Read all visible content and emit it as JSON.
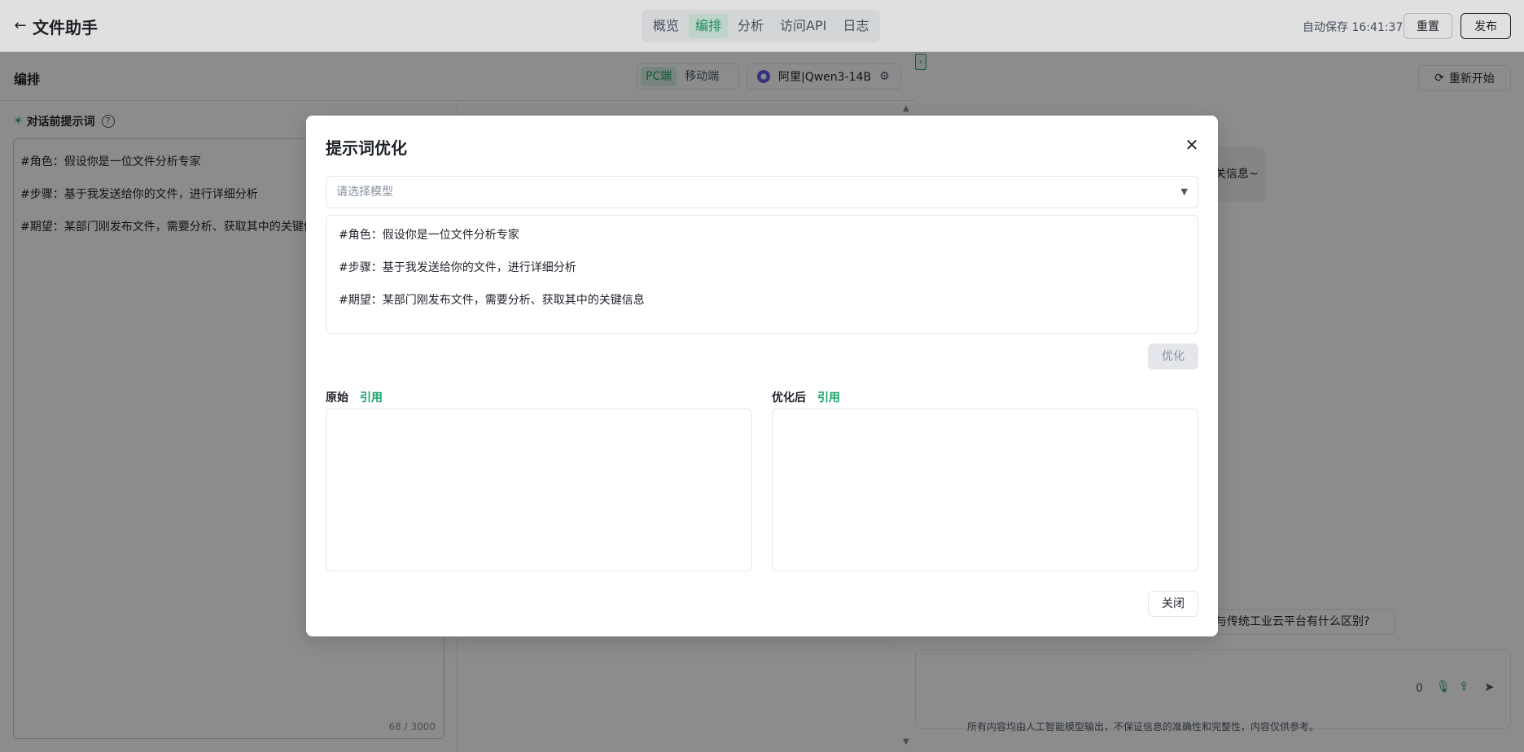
{
  "header": {
    "back_icon": "arrow-left-icon",
    "title": "文件助手",
    "tabs": [
      {
        "label": "概览",
        "active": false
      },
      {
        "label": "编排",
        "active": true
      },
      {
        "label": "分析",
        "active": false
      },
      {
        "label": "访问API",
        "active": false
      },
      {
        "label": "日志",
        "active": false
      }
    ],
    "autosave": "自动保存 16:41:37",
    "reset_label": "重置",
    "publish_label": "发布"
  },
  "editor": {
    "title": "编排",
    "devices": [
      {
        "label": "PC端",
        "active": true
      },
      {
        "label": "移动端",
        "active": false
      }
    ],
    "model_name": "阿里|Qwen3-14B",
    "prompt_label": "对话前提示词",
    "prompt_lines": [
      "#角色：假设你是一位文件分析专家",
      "#步骤：基于我发送给你的文件，进行详细分析",
      "#期望：某部门刚发布文件，需要分析、获取其中的关键信"
    ],
    "counter": "68 / 3000"
  },
  "preview": {
    "restart_label": "重新开始",
    "bubble_text": "关信息~",
    "suggestion": "台与传统工业云平台有什么区别?",
    "char_count": "0",
    "disclaimer": "所有内容均由人工智能模型输出，不保证信息的准确性和完整性，内容仅供参考。"
  },
  "modal": {
    "title": "提示词优化",
    "close_icon": "close-icon",
    "select_placeholder": "请选择模型",
    "prompt_lines": [
      "#角色：假设你是一位文件分析专家",
      "#步骤：基于我发送给你的文件，进行详细分析",
      "#期望：某部门刚发布文件，需要分析、获取其中的关键信息"
    ],
    "optimize_label": "优化",
    "original_label": "原始",
    "optimized_label": "优化后",
    "reference_label": "引用",
    "close_label": "关闭"
  },
  "colors": {
    "accent": "#1aa36b",
    "overlay": "rgba(0,0,0,0.45)"
  }
}
